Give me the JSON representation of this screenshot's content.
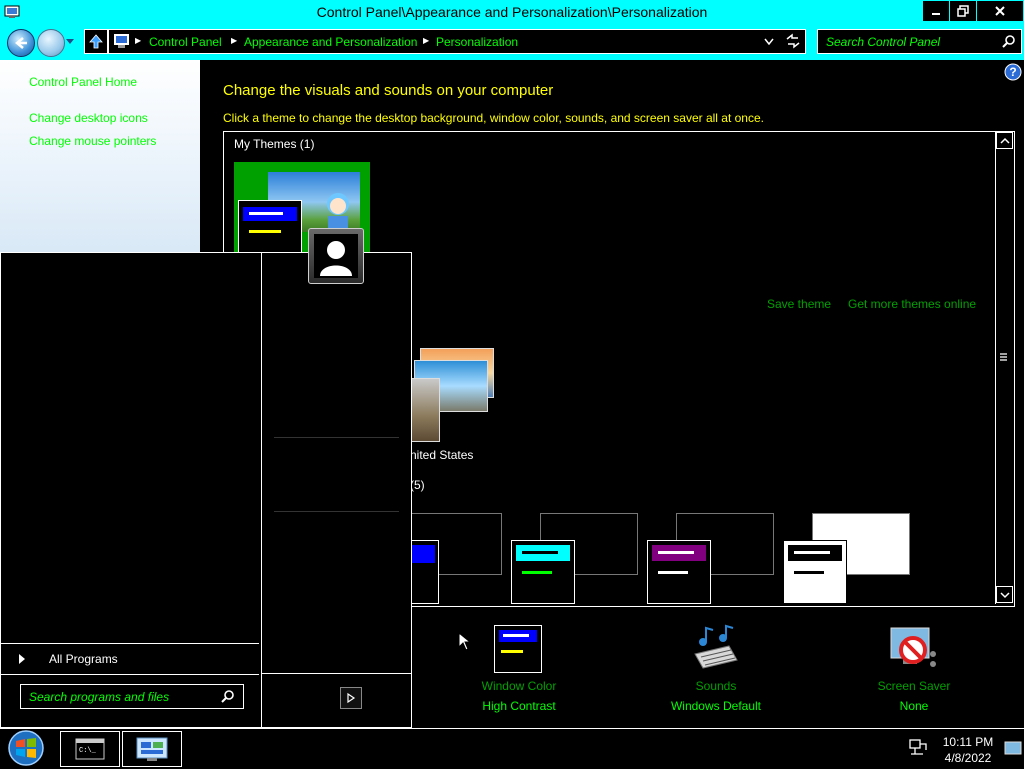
{
  "window": {
    "title": "Control Panel\\Appearance and Personalization\\Personalization"
  },
  "address": {
    "segments": [
      "Control Panel",
      "Appearance and Personalization",
      "Personalization"
    ],
    "search_placeholder": "Search Control Panel"
  },
  "left_pane": {
    "links": [
      "Control Panel Home",
      "Change desktop icons",
      "Change mouse pointers"
    ]
  },
  "main": {
    "heading": "Change the visuals and sounds on your computer",
    "subheading": "Click a theme to change the desktop background, window color, sounds, and screen saver all at once.",
    "my_themes_label": "My Themes (1)",
    "save_theme": "Save theme",
    "get_more_themes": "Get more themes online",
    "partial_theme_name": "nited States",
    "partial_group_count": "(5)"
  },
  "bottom_settings": [
    {
      "label": "Window Color",
      "value": "High Contrast",
      "icon": "window-color-icon"
    },
    {
      "label": "Sounds",
      "value": "Windows Default",
      "icon": "sounds-icon"
    },
    {
      "label": "Screen Saver",
      "value": "None",
      "icon": "screen-saver-icon"
    }
  ],
  "start_menu": {
    "all_programs": "All Programs",
    "search_placeholder": "Search programs and files"
  },
  "taskbar": {
    "time": "10:11 PM",
    "date": "4/8/2022"
  },
  "colors": {
    "accent": "#00ffff",
    "link": "#00ff00",
    "heading": "#ffff00"
  }
}
